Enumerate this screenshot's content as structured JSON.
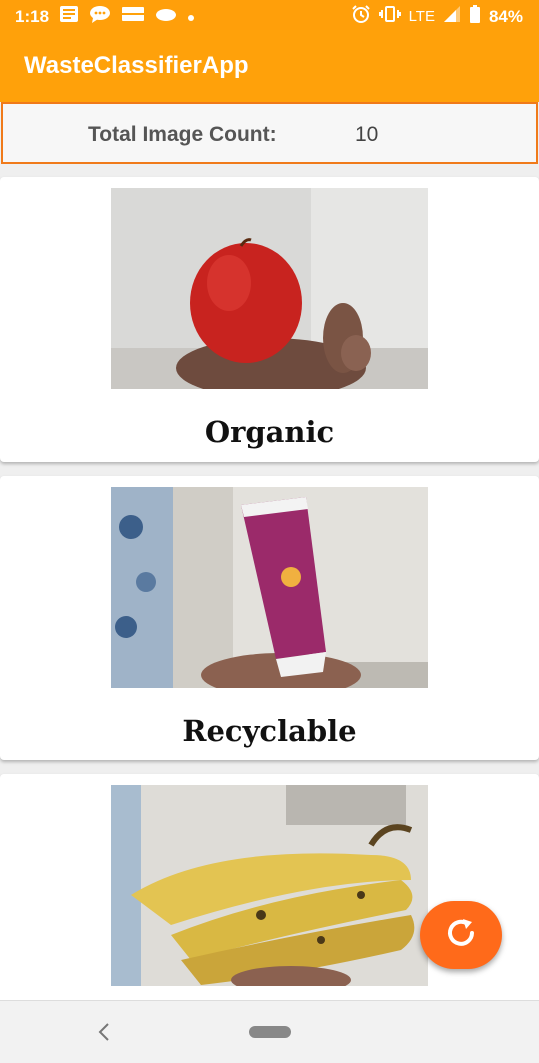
{
  "status_bar": {
    "time": "1:18",
    "network": "LTE",
    "battery": "84%",
    "icons": [
      "notes-icon",
      "chat-icon",
      "card-icon",
      "cloud-icon",
      "dot-icon",
      "alarm-icon",
      "vibrate-icon",
      "signal-icon",
      "battery-icon"
    ]
  },
  "app_bar": {
    "title": "WasteClassifierApp"
  },
  "summary": {
    "label": "Total Image Count:",
    "value": "10"
  },
  "cards": [
    {
      "label": "Organic",
      "image": "apple-photo"
    },
    {
      "label": "Recyclable",
      "image": "toothpaste-tube-photo"
    },
    {
      "label": "",
      "image": "bananas-photo"
    }
  ],
  "fab": {
    "icon": "refresh-icon",
    "color": "#ff6a1a"
  },
  "nav_bar": {
    "icons": [
      "back-icon",
      "home-pill-icon"
    ]
  },
  "colors": {
    "app_bar": "#ffa10a",
    "accent": "#f07a1a"
  }
}
